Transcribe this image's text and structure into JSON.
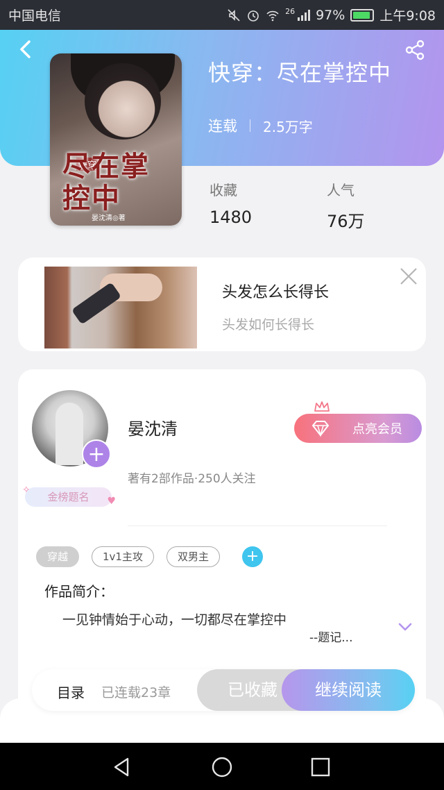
{
  "status_bar": {
    "carrier": "中国电信",
    "signal": "26",
    "battery": "97%",
    "time": "上午9:08"
  },
  "header": {
    "back_icon": "chevron-left-icon",
    "share_icon": "share-icon",
    "colors": {
      "gradient_start": "#56d1f3",
      "gradient_end": "#b394ee"
    }
  },
  "book": {
    "title": "快穿：尽在掌控中",
    "status": "连载",
    "word_count": "2.5万字",
    "cover": {
      "tag": "快穿",
      "art_title": "尽在掌控中",
      "author": "晏沈清◎著"
    },
    "stats": [
      {
        "label": "收藏",
        "value": "1480"
      },
      {
        "label": "人气",
        "value": "76万"
      }
    ]
  },
  "ad": {
    "title": "头发怎么长得长",
    "subtitle": "头发如何长得长",
    "close_icon": "close-icon"
  },
  "author": {
    "name": "晏沈清",
    "info": "著有2部作品·250人关注",
    "badge": "金榜题名",
    "vip_button": "点亮会员",
    "follow_icon": "plus-icon"
  },
  "tags": [
    "穿越",
    "1v1主攻",
    "双男主"
  ],
  "intro": {
    "label": "作品简介：",
    "text": "一见钟情始于心动，一切都尽在掌控中",
    "more": "--题记..."
  },
  "action_bar": {
    "toc_label": "目录",
    "toc_count": "已连载23章",
    "collected": "已收藏",
    "continue": "继续阅读"
  }
}
